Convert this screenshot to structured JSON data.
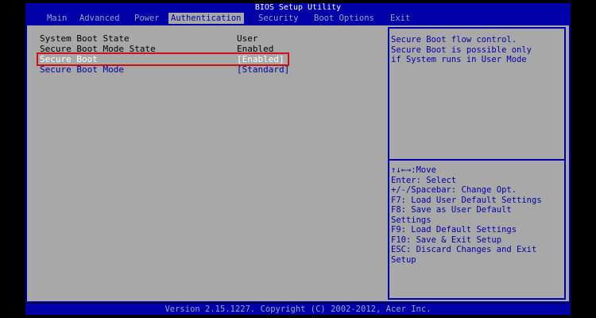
{
  "title": "BIOS Setup Utility",
  "menu": [
    "Main",
    "Advanced",
    "Power",
    "Authentication",
    "Security",
    "Boot Options",
    "Exit"
  ],
  "settings": [
    {
      "label": "System Boot State",
      "value": "User"
    },
    {
      "label": "Secure Boot Mode State",
      "value": "Enabled"
    },
    {
      "label": "Secure Boot",
      "value": "[Enabled]"
    },
    {
      "label": "Secure Boot Mode",
      "value": "[Standard]"
    }
  ],
  "help_text": [
    "Secure Boot flow control.",
    "Secure Boot is possible only",
    "if System runs in User Mode"
  ],
  "keys": [
    "↑↓←→:Move",
    "Enter: Select",
    "+/-/Spacebar: Change Opt.",
    "F7: Load User Default Settings",
    "F8: Save as User Default",
    "Settings",
    "F9: Load Default Settings",
    "F10: Save & Exit Setup",
    "ESC: Discard Changes and Exit",
    "Setup"
  ],
  "footer": "Version 2.15.1227. Copyright (C) 2002-2012, Acer Inc.",
  "colors": {
    "bios_blue": "#0000a8",
    "panel_gray": "#a8a8a8",
    "selection_outline": "#d01010"
  }
}
